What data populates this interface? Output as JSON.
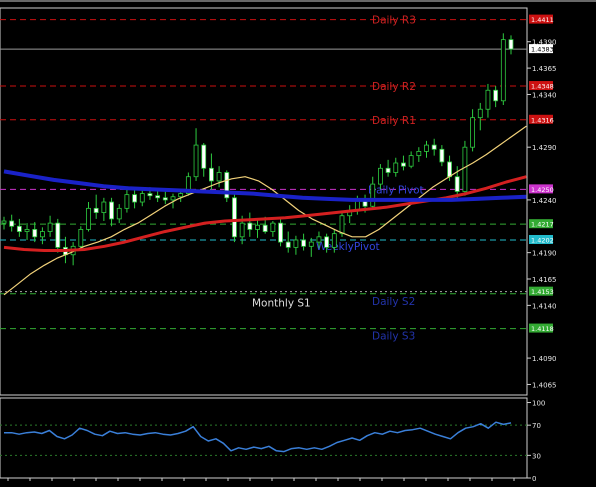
{
  "chart_data": [
    {
      "type": "candlestick",
      "price_axis": {
        "ylim": [
          1.4055,
          1.4422
        ],
        "ticks": [
          "1.4390",
          "1.4365",
          "1.4340",
          "1.4290",
          "1.4240",
          "1.4190",
          "1.4165",
          "1.4140",
          "1.4090",
          "1.4065"
        ]
      },
      "levels": [
        {
          "label": "Daily R3",
          "value": 1.4411,
          "tag": "1.4411",
          "line_color": "#cc1111",
          "tag_color": "#cc1111",
          "text_color": "#cc2222",
          "dash": "6,4"
        },
        {
          "label": "",
          "value": 1.4383,
          "tag": "1.4383",
          "line_color": "#9a9a9a",
          "tag_color": "#ffffff",
          "text_color": "#cccccc",
          "dash": "none",
          "tag_text_color": "#000000"
        },
        {
          "label": "Daily R2",
          "value": 1.4348,
          "tag": "1.4348",
          "line_color": "#cc1111",
          "tag_color": "#cc1111",
          "text_color": "#cc2222",
          "dash": "6,4"
        },
        {
          "label": "Daily R1",
          "value": 1.4316,
          "tag": "1.4316",
          "line_color": "#cc1111",
          "tag_color": "#cc1111",
          "text_color": "#cc2222",
          "dash": "6,4"
        },
        {
          "label": "Daily Pivot",
          "value": 1.425,
          "tag": "1.4250",
          "line_color": "#cc33cc",
          "tag_color": "#cc33cc",
          "text_color": "#3344dd",
          "dash": "6,4"
        },
        {
          "label": "",
          "value": 1.4217,
          "tag": "1.4217",
          "line_color": "#33aa33",
          "tag_color": "#33aa33",
          "text_color": "#33aa33",
          "dash": "6,4"
        },
        {
          "label": "WeeklyPivot",
          "value": 1.4202,
          "tag": "1.4202",
          "line_color": "#22bbcc",
          "tag_color": "#22bbcc",
          "text_color": "#3344dd",
          "dash": "6,4"
        },
        {
          "label": "Monthly S1",
          "value": 1.4153,
          "tag": "1.4153",
          "line_color": "#aaaaaa",
          "tag_color": "#33aa33",
          "text_color": "#dddddd",
          "dash": "2,3"
        },
        {
          "label": "Daily S2",
          "value": 1.4151,
          "tag": "",
          "line_color": "#33aa33",
          "tag_color": "#33aa33",
          "text_color": "#2233aa",
          "dash": "6,4"
        },
        {
          "label": "Daily S3",
          "value": 1.4118,
          "tag": "1.4118",
          "line_color": "#33aa33",
          "tag_color": "#33aa33",
          "text_color": "#2233aa",
          "dash": "6,4"
        }
      ],
      "candles": [
        {
          "o": 1.4218,
          "h": 1.4224,
          "l": 1.4212,
          "c": 1.422
        },
        {
          "o": 1.422,
          "h": 1.4226,
          "l": 1.421,
          "c": 1.4215
        },
        {
          "o": 1.4215,
          "h": 1.4222,
          "l": 1.4205,
          "c": 1.421
        },
        {
          "o": 1.421,
          "h": 1.4218,
          "l": 1.4202,
          "c": 1.4212
        },
        {
          "o": 1.4212,
          "h": 1.4219,
          "l": 1.42,
          "c": 1.4205
        },
        {
          "o": 1.4205,
          "h": 1.4214,
          "l": 1.4198,
          "c": 1.421
        },
        {
          "o": 1.421,
          "h": 1.4225,
          "l": 1.4205,
          "c": 1.4218
        },
        {
          "o": 1.4218,
          "h": 1.4222,
          "l": 1.419,
          "c": 1.4195
        },
        {
          "o": 1.4195,
          "h": 1.4205,
          "l": 1.418,
          "c": 1.4188
        },
        {
          "o": 1.4188,
          "h": 1.42,
          "l": 1.4178,
          "c": 1.4196
        },
        {
          "o": 1.4196,
          "h": 1.4215,
          "l": 1.4192,
          "c": 1.4212
        },
        {
          "o": 1.4212,
          "h": 1.4238,
          "l": 1.421,
          "c": 1.4232
        },
        {
          "o": 1.4232,
          "h": 1.4245,
          "l": 1.4222,
          "c": 1.4228
        },
        {
          "o": 1.4228,
          "h": 1.4242,
          "l": 1.422,
          "c": 1.4238
        },
        {
          "o": 1.4238,
          "h": 1.4242,
          "l": 1.4215,
          "c": 1.4222
        },
        {
          "o": 1.4222,
          "h": 1.4236,
          "l": 1.4218,
          "c": 1.4232
        },
        {
          "o": 1.4232,
          "h": 1.4252,
          "l": 1.4228,
          "c": 1.4245
        },
        {
          "o": 1.4245,
          "h": 1.425,
          "l": 1.4232,
          "c": 1.4238
        },
        {
          "o": 1.4238,
          "h": 1.425,
          "l": 1.4234,
          "c": 1.4246
        },
        {
          "o": 1.4246,
          "h": 1.4252,
          "l": 1.424,
          "c": 1.4244
        },
        {
          "o": 1.4244,
          "h": 1.425,
          "l": 1.4238,
          "c": 1.4242
        },
        {
          "o": 1.4242,
          "h": 1.4248,
          "l": 1.4236,
          "c": 1.424
        },
        {
          "o": 1.424,
          "h": 1.4246,
          "l": 1.4232,
          "c": 1.4243
        },
        {
          "o": 1.4243,
          "h": 1.425,
          "l": 1.4238,
          "c": 1.4246
        },
        {
          "o": 1.4246,
          "h": 1.4266,
          "l": 1.4244,
          "c": 1.4262
        },
        {
          "o": 1.4262,
          "h": 1.4308,
          "l": 1.4258,
          "c": 1.4292
        },
        {
          "o": 1.4292,
          "h": 1.4294,
          "l": 1.4262,
          "c": 1.427
        },
        {
          "o": 1.427,
          "h": 1.4284,
          "l": 1.4248,
          "c": 1.4258
        },
        {
          "o": 1.4258,
          "h": 1.4272,
          "l": 1.4252,
          "c": 1.4266
        },
        {
          "o": 1.4266,
          "h": 1.4268,
          "l": 1.4238,
          "c": 1.4242
        },
        {
          "o": 1.4242,
          "h": 1.4248,
          "l": 1.42,
          "c": 1.4205
        },
        {
          "o": 1.4205,
          "h": 1.4225,
          "l": 1.4198,
          "c": 1.4218
        },
        {
          "o": 1.4218,
          "h": 1.4228,
          "l": 1.4205,
          "c": 1.4212
        },
        {
          "o": 1.4212,
          "h": 1.4222,
          "l": 1.4204,
          "c": 1.4216
        },
        {
          "o": 1.4216,
          "h": 1.4224,
          "l": 1.4208,
          "c": 1.421
        },
        {
          "o": 1.421,
          "h": 1.422,
          "l": 1.4205,
          "c": 1.4218
        },
        {
          "o": 1.4218,
          "h": 1.4224,
          "l": 1.4196,
          "c": 1.42
        },
        {
          "o": 1.42,
          "h": 1.421,
          "l": 1.419,
          "c": 1.4195
        },
        {
          "o": 1.4195,
          "h": 1.4206,
          "l": 1.4188,
          "c": 1.4202
        },
        {
          "o": 1.4202,
          "h": 1.4208,
          "l": 1.4192,
          "c": 1.4196
        },
        {
          "o": 1.4196,
          "h": 1.4204,
          "l": 1.4186,
          "c": 1.42
        },
        {
          "o": 1.42,
          "h": 1.421,
          "l": 1.4194,
          "c": 1.4205
        },
        {
          "o": 1.4205,
          "h": 1.4208,
          "l": 1.419,
          "c": 1.4195
        },
        {
          "o": 1.4195,
          "h": 1.4212,
          "l": 1.419,
          "c": 1.4208
        },
        {
          "o": 1.4208,
          "h": 1.4228,
          "l": 1.4205,
          "c": 1.4225
        },
        {
          "o": 1.4225,
          "h": 1.4235,
          "l": 1.4218,
          "c": 1.423
        },
        {
          "o": 1.423,
          "h": 1.4244,
          "l": 1.4226,
          "c": 1.424
        },
        {
          "o": 1.424,
          "h": 1.4245,
          "l": 1.4228,
          "c": 1.4234
        },
        {
          "o": 1.4234,
          "h": 1.4262,
          "l": 1.4232,
          "c": 1.4255
        },
        {
          "o": 1.4255,
          "h": 1.4274,
          "l": 1.425,
          "c": 1.427
        },
        {
          "o": 1.427,
          "h": 1.4278,
          "l": 1.4262,
          "c": 1.4266
        },
        {
          "o": 1.4266,
          "h": 1.428,
          "l": 1.4262,
          "c": 1.4275
        },
        {
          "o": 1.4275,
          "h": 1.4282,
          "l": 1.4268,
          "c": 1.4272
        },
        {
          "o": 1.4272,
          "h": 1.4286,
          "l": 1.427,
          "c": 1.4282
        },
        {
          "o": 1.4282,
          "h": 1.429,
          "l": 1.4276,
          "c": 1.4286
        },
        {
          "o": 1.4286,
          "h": 1.4296,
          "l": 1.428,
          "c": 1.4292
        },
        {
          "o": 1.4292,
          "h": 1.4298,
          "l": 1.4282,
          "c": 1.4288
        },
        {
          "o": 1.4288,
          "h": 1.4292,
          "l": 1.4272,
          "c": 1.4276
        },
        {
          "o": 1.4276,
          "h": 1.4282,
          "l": 1.4258,
          "c": 1.4262
        },
        {
          "o": 1.4262,
          "h": 1.4272,
          "l": 1.424,
          "c": 1.4248
        },
        {
          "o": 1.4248,
          "h": 1.4296,
          "l": 1.4244,
          "c": 1.429
        },
        {
          "o": 1.429,
          "h": 1.4326,
          "l": 1.4286,
          "c": 1.4318
        },
        {
          "o": 1.4318,
          "h": 1.4332,
          "l": 1.4306,
          "c": 1.4326
        },
        {
          "o": 1.4326,
          "h": 1.435,
          "l": 1.4318,
          "c": 1.4344
        },
        {
          "o": 1.4344,
          "h": 1.4348,
          "l": 1.4328,
          "c": 1.4334
        },
        {
          "o": 1.4334,
          "h": 1.4398,
          "l": 1.433,
          "c": 1.4392
        },
        {
          "o": 1.4392,
          "h": 1.4396,
          "l": 1.4378,
          "c": 1.4383
        }
      ],
      "moving_averages": [
        {
          "color": "#f2d27a",
          "width": 1.2,
          "values": [
            1.415,
            1.416,
            1.417,
            1.4178,
            1.4185,
            1.419,
            1.4196,
            1.42,
            1.4205,
            1.4212,
            1.4218,
            1.4226,
            1.4234,
            1.4241,
            1.4246,
            1.4251,
            1.4256,
            1.426,
            1.4262,
            1.4258,
            1.425,
            1.424,
            1.423,
            1.4222,
            1.4216,
            1.421,
            1.4205,
            1.4205,
            1.4212,
            1.4222,
            1.4232,
            1.4242,
            1.4252,
            1.426,
            1.4268,
            1.4275,
            1.4283,
            1.4292,
            1.4301,
            1.431
          ]
        },
        {
          "color": "#d42020",
          "width": 3,
          "values": [
            1.4195,
            1.4193,
            1.4192,
            1.4192,
            1.4193,
            1.4196,
            1.42,
            1.4205,
            1.421,
            1.4214,
            1.4218,
            1.422,
            1.4221,
            1.4222,
            1.4223,
            1.4225,
            1.4227,
            1.4229,
            1.4231,
            1.4233,
            1.4236,
            1.4239,
            1.4242,
            1.4246,
            1.4251,
            1.4257,
            1.4262
          ]
        },
        {
          "color": "#1a22c8",
          "width": 4,
          "values": [
            1.4267,
            1.4263,
            1.4259,
            1.4256,
            1.4253,
            1.4251,
            1.425,
            1.4249,
            1.4248,
            1.4247,
            1.4246,
            1.4244,
            1.4242,
            1.4241,
            1.424,
            1.424,
            1.424,
            1.424,
            1.424,
            1.4241,
            1.4242,
            1.4243
          ]
        }
      ],
      "ma_spans": [
        [
          0,
          68
        ],
        [
          0,
          68
        ],
        [
          0,
          68
        ]
      ]
    },
    {
      "type": "line",
      "ylim": [
        0,
        106
      ],
      "ticks": [
        "100",
        "70",
        "30",
        "0"
      ],
      "levels": [
        70,
        30
      ],
      "values": [
        60,
        60,
        58,
        60,
        61,
        59,
        63,
        55,
        52,
        57,
        66,
        63,
        58,
        56,
        62,
        59,
        60,
        58,
        57,
        59,
        60,
        58,
        57,
        59,
        62,
        68,
        55,
        49,
        52,
        46,
        36,
        40,
        38,
        41,
        39,
        42,
        36,
        35,
        39,
        40,
        38,
        40,
        38,
        42,
        47,
        50,
        53,
        50,
        56,
        60,
        58,
        62,
        60,
        63,
        64,
        66,
        62,
        58,
        55,
        52,
        60,
        66,
        68,
        72,
        66,
        74,
        71,
        73
      ],
      "color": "#3a7fd8"
    }
  ]
}
